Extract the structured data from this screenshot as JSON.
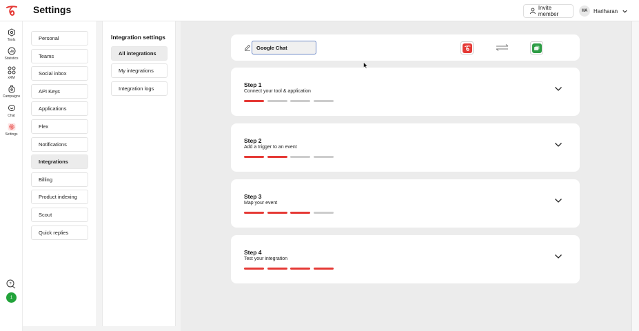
{
  "app": {
    "title": "Settings",
    "logo_icon": "brand-logo-icon",
    "brand_color": "#e53935"
  },
  "header": {
    "invite_label": "Invite member",
    "invite_icon": "user-icon",
    "user_initials": "HA",
    "user_name": "Hariharan"
  },
  "rail": {
    "items": [
      {
        "label": "Tools",
        "icon": "tools-icon"
      },
      {
        "label": "Statistics",
        "icon": "statistics-icon"
      },
      {
        "label": "xRM",
        "icon": "xrm-icon"
      },
      {
        "label": "Campaigns",
        "icon": "campaigns-icon"
      },
      {
        "label": "Chat",
        "icon": "chat-icon"
      },
      {
        "label": "Settings",
        "icon": "settings-icon",
        "active": true
      }
    ],
    "help_icon": "help-chat-icon",
    "badge_text": "1",
    "badge_color": "#22a33a"
  },
  "settings_menu": {
    "items": [
      "Personal",
      "Teams",
      "Social inbox",
      "API Keys",
      "Applications",
      "Flex",
      "Notifications",
      "Integrations",
      "Billing",
      "Product indexing",
      "Scout",
      "Quick replies"
    ],
    "active": "Integrations"
  },
  "integration_settings": {
    "title": "Integration settings",
    "items": [
      "All integrations",
      "My integrations",
      "Integration logs"
    ],
    "active": "All integrations"
  },
  "integration": {
    "name_value": "Google Chat",
    "source_app_icon": "brand-logo-icon",
    "target_app_icon": "google-chat-icon",
    "swap_icon": "swap-arrows-icon"
  },
  "steps": [
    {
      "title": "Step 1",
      "subtitle": "Connect your tool & application",
      "completed": 1,
      "total": 4
    },
    {
      "title": "Step 2",
      "subtitle": "Add a trigger to an event",
      "completed": 2,
      "total": 4
    },
    {
      "title": "Step 3",
      "subtitle": "Map your event",
      "completed": 3,
      "total": 4
    },
    {
      "title": "Step 4",
      "subtitle": "Test your integration",
      "completed": 4,
      "total": 4
    }
  ]
}
